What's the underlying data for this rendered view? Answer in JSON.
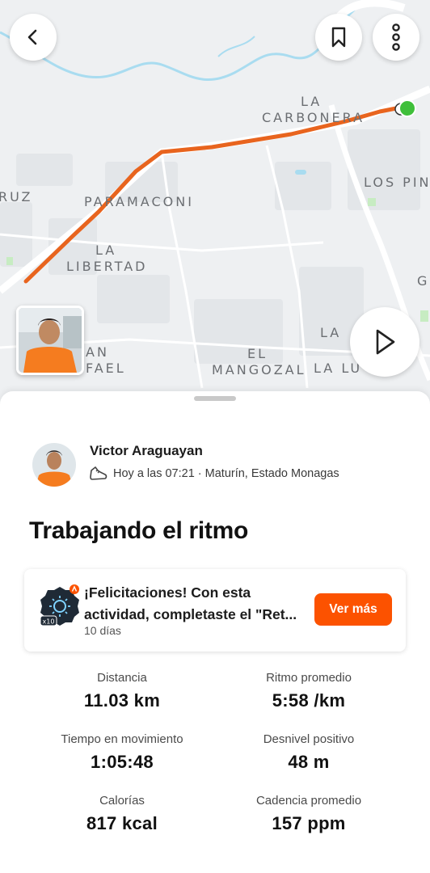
{
  "map": {
    "labels": [
      "LA",
      "CARBONERA",
      "LOS PINO",
      "RUZ",
      "PARAMACONI",
      "LA",
      "LIBERTAD",
      "AN",
      "FAEL",
      "EL",
      "MANGOZAL",
      "LA",
      "LA LU",
      "G"
    ]
  },
  "header": {
    "back_icon": "chevron-left-icon",
    "bookmark_icon": "bookmark-icon",
    "more_icon": "more-vertical-icon",
    "play_icon": "play-icon"
  },
  "athlete": {
    "name": "Victor Araguayan",
    "meta": "Hoy a las 07:21 · Maturín, Estado Monagas",
    "activity_icon": "shoe-icon"
  },
  "activity": {
    "title": "Trabajando el ritmo"
  },
  "challenge": {
    "text": "¡Felicitaciones! Con esta actividad, completaste el \"Ret...",
    "sub": "10 días",
    "badge_count": "x10",
    "button": "Ver más"
  },
  "stats": [
    {
      "label": "Distancia",
      "value": "11.03 km"
    },
    {
      "label": "Ritmo promedio",
      "value": "5:58 /km"
    },
    {
      "label": "Tiempo en movimiento",
      "value": "1:05:48"
    },
    {
      "label": "Desnivel positivo",
      "value": "48 m"
    },
    {
      "label": "Calorías",
      "value": "817 kcal"
    },
    {
      "label": "Cadencia promedio",
      "value": "157 ppm"
    }
  ],
  "colors": {
    "accent": "#fc5200",
    "route": "#e8641e",
    "end_marker": "#3fbf3a",
    "river": "#a9dcf0"
  }
}
